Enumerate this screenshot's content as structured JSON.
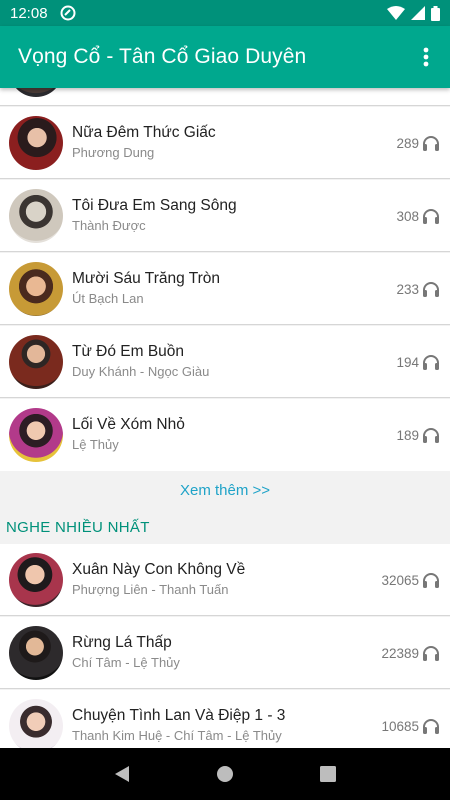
{
  "status_bar": {
    "time": "12:08"
  },
  "app_bar": {
    "title": "Vọng Cổ - Tân Cổ Giao Duyên"
  },
  "recent_list": [
    {
      "title": "Nữa Đêm Thức Giấc",
      "artist": "Phương Dung",
      "plays": "289"
    },
    {
      "title": "Tôi Đưa Em Sang Sông",
      "artist": "Thành Được",
      "plays": "308"
    },
    {
      "title": "Mười Sáu Trăng Tròn",
      "artist": "Út Bạch Lan",
      "plays": "233"
    },
    {
      "title": "Từ Đó Em Buồn",
      "artist": "Duy Khánh - Ngọc Giàu",
      "plays": "194"
    },
    {
      "title": "Lối Về Xóm Nhỏ",
      "artist": "Lệ Thủy",
      "plays": "189"
    }
  ],
  "see_more_label": "Xem thêm >>",
  "most_listened": {
    "header": "NGHE NHIỀU NHẤT",
    "items": [
      {
        "title": "Xuân Này Con Không Về",
        "artist": "Phượng Liên - Thanh Tuấn",
        "plays": "32065"
      },
      {
        "title": "Rừng Lá Thấp",
        "artist": "Chí Tâm - Lệ Thủy",
        "plays": "22389"
      },
      {
        "title": "Chuyện Tình Lan Và Điệp 1 - 3",
        "artist": "Thanh Kim Huệ - Chí Tâm - Lệ Thủy",
        "plays": "10685"
      }
    ]
  },
  "colors": {
    "status_bar": "#00917a",
    "app_bar": "#00a88e",
    "accent_link": "#1fa3c8",
    "section_header": "#00917a"
  }
}
